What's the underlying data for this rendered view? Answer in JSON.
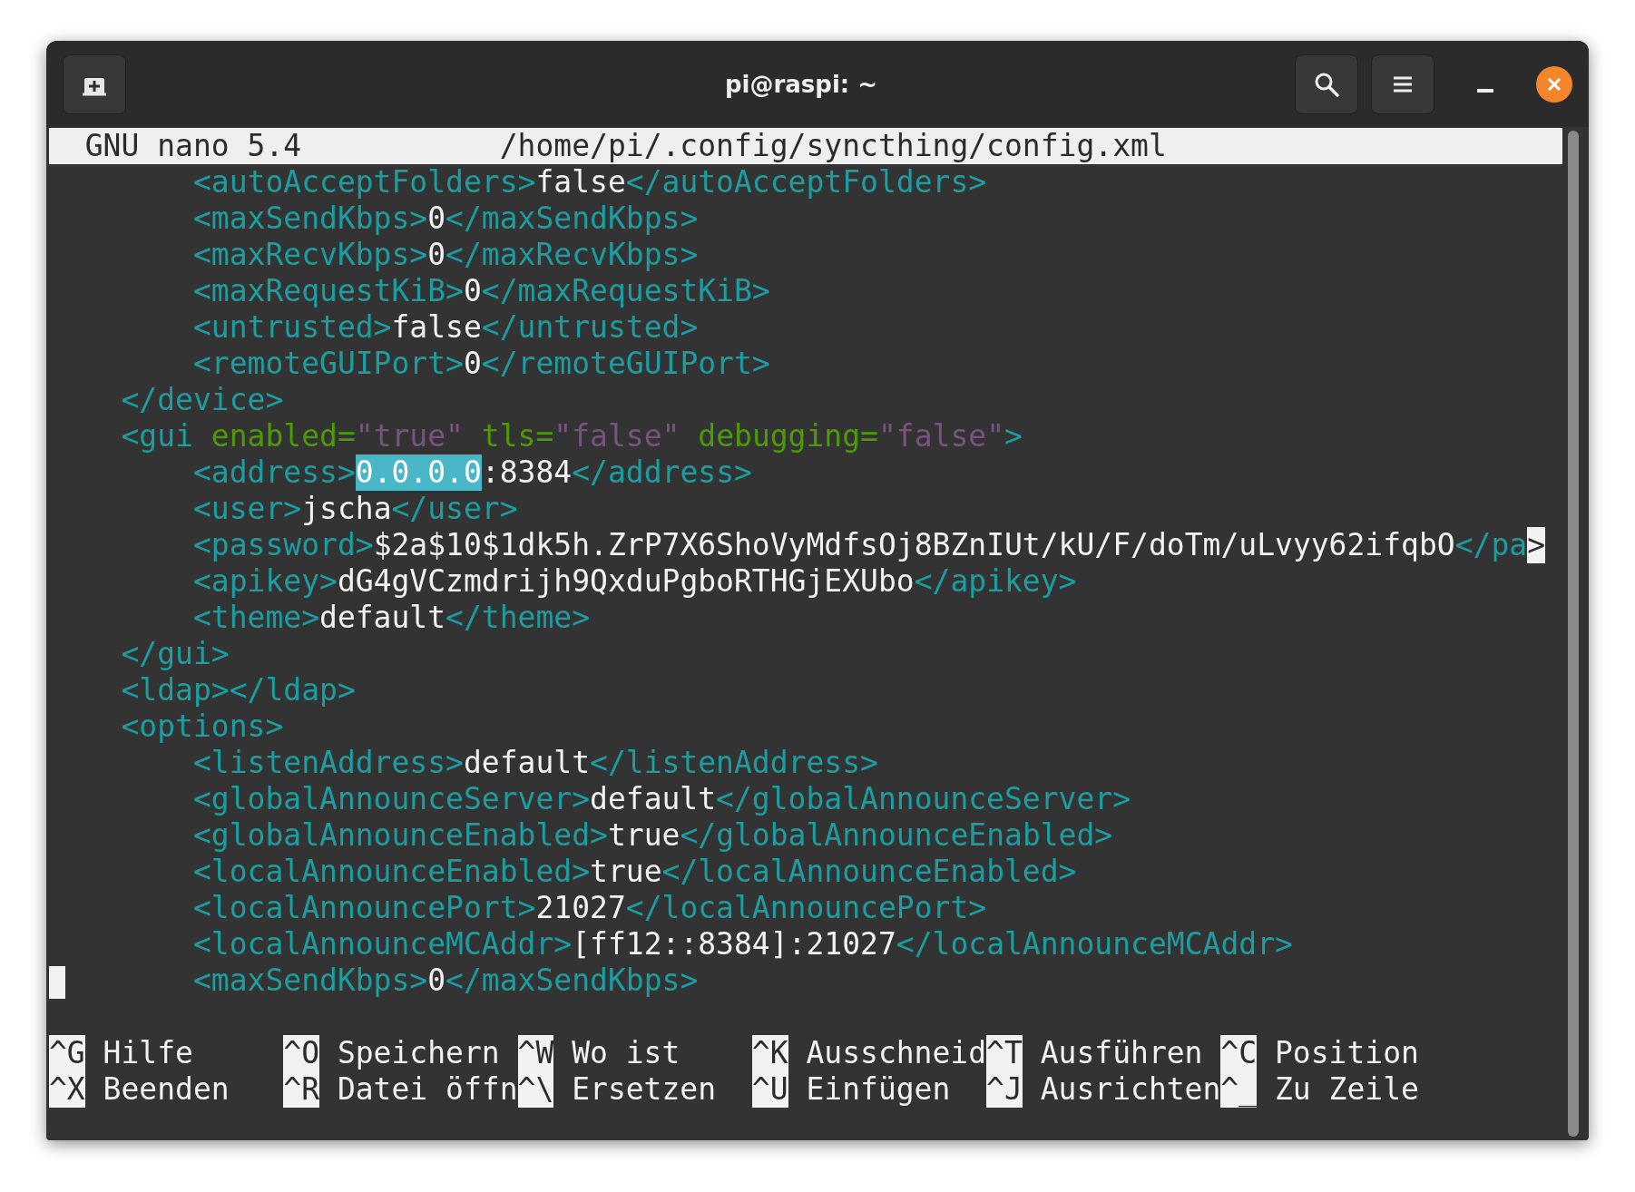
{
  "window": {
    "title": "pi@raspi: ~"
  },
  "nano_header": {
    "version": "GNU nano 5.4",
    "file": "/home/pi/.config/syncthing/config.xml"
  },
  "lines": [
    {
      "cursor": false,
      "segments": [
        {
          "kind": "tag",
          "text": "        <autoAcceptFolders>"
        },
        {
          "kind": "text",
          "text": "false"
        },
        {
          "kind": "tag",
          "text": "</autoAcceptFolders>"
        }
      ]
    },
    {
      "cursor": false,
      "segments": [
        {
          "kind": "tag",
          "text": "        <maxSendKbps>"
        },
        {
          "kind": "text",
          "text": "0"
        },
        {
          "kind": "tag",
          "text": "</maxSendKbps>"
        }
      ]
    },
    {
      "cursor": false,
      "segments": [
        {
          "kind": "tag",
          "text": "        <maxRecvKbps>"
        },
        {
          "kind": "text",
          "text": "0"
        },
        {
          "kind": "tag",
          "text": "</maxRecvKbps>"
        }
      ]
    },
    {
      "cursor": false,
      "segments": [
        {
          "kind": "tag",
          "text": "        <maxRequestKiB>"
        },
        {
          "kind": "text",
          "text": "0"
        },
        {
          "kind": "tag",
          "text": "</maxRequestKiB>"
        }
      ]
    },
    {
      "cursor": false,
      "segments": [
        {
          "kind": "tag",
          "text": "        <untrusted>"
        },
        {
          "kind": "text",
          "text": "false"
        },
        {
          "kind": "tag",
          "text": "</untrusted>"
        }
      ]
    },
    {
      "cursor": false,
      "segments": [
        {
          "kind": "tag",
          "text": "        <remoteGUIPort>"
        },
        {
          "kind": "text",
          "text": "0"
        },
        {
          "kind": "tag",
          "text": "</remoteGUIPort>"
        }
      ]
    },
    {
      "cursor": false,
      "segments": [
        {
          "kind": "tag",
          "text": "    </device>"
        }
      ]
    },
    {
      "cursor": false,
      "segments": [
        {
          "kind": "tag",
          "text": "    <gui"
        },
        {
          "kind": "attr",
          "text": " enabled="
        },
        {
          "kind": "value",
          "text": "\"true\""
        },
        {
          "kind": "attr",
          "text": " tls="
        },
        {
          "kind": "value",
          "text": "\"false\""
        },
        {
          "kind": "attr",
          "text": " debugging="
        },
        {
          "kind": "value",
          "text": "\"false\""
        },
        {
          "kind": "tag",
          "text": ">"
        }
      ]
    },
    {
      "cursor": false,
      "segments": [
        {
          "kind": "tag",
          "text": "        <address>"
        },
        {
          "kind": "selection",
          "text": "0.0.0.0"
        },
        {
          "kind": "text",
          "text": ":8384"
        },
        {
          "kind": "tag",
          "text": "</address>"
        }
      ]
    },
    {
      "cursor": false,
      "segments": [
        {
          "kind": "tag",
          "text": "        <user>"
        },
        {
          "kind": "text",
          "text": "jscha"
        },
        {
          "kind": "tag",
          "text": "</user>"
        }
      ]
    },
    {
      "cursor": false,
      "segments": [
        {
          "kind": "tag",
          "text": "        <password>"
        },
        {
          "kind": "text",
          "text": "$2a$10$1dk5h.ZrP7X6ShoVyMdfsOj8BZnIUt/kU/F/doTm/uLvyy62ifqbO"
        },
        {
          "kind": "tag",
          "text": "</pa"
        },
        {
          "kind": "overflow",
          "text": ">"
        }
      ]
    },
    {
      "cursor": false,
      "segments": [
        {
          "kind": "tag",
          "text": "        <apikey>"
        },
        {
          "kind": "text",
          "text": "dG4gVCzmdrijh9QxduPgboRTHGjEXUbo"
        },
        {
          "kind": "tag",
          "text": "</apikey>"
        }
      ]
    },
    {
      "cursor": false,
      "segments": [
        {
          "kind": "tag",
          "text": "        <theme>"
        },
        {
          "kind": "text",
          "text": "default"
        },
        {
          "kind": "tag",
          "text": "</theme>"
        }
      ]
    },
    {
      "cursor": false,
      "segments": [
        {
          "kind": "tag",
          "text": "    </gui>"
        }
      ]
    },
    {
      "cursor": false,
      "segments": [
        {
          "kind": "tag",
          "text": "    <ldap></ldap>"
        }
      ]
    },
    {
      "cursor": false,
      "segments": [
        {
          "kind": "tag",
          "text": "    <options>"
        }
      ]
    },
    {
      "cursor": false,
      "segments": [
        {
          "kind": "tag",
          "text": "        <listenAddress>"
        },
        {
          "kind": "text",
          "text": "default"
        },
        {
          "kind": "tag",
          "text": "</listenAddress>"
        }
      ]
    },
    {
      "cursor": false,
      "segments": [
        {
          "kind": "tag",
          "text": "        <globalAnnounceServer>"
        },
        {
          "kind": "text",
          "text": "default"
        },
        {
          "kind": "tag",
          "text": "</globalAnnounceServer>"
        }
      ]
    },
    {
      "cursor": false,
      "segments": [
        {
          "kind": "tag",
          "text": "        <globalAnnounceEnabled>"
        },
        {
          "kind": "text",
          "text": "true"
        },
        {
          "kind": "tag",
          "text": "</globalAnnounceEnabled>"
        }
      ]
    },
    {
      "cursor": false,
      "segments": [
        {
          "kind": "tag",
          "text": "        <localAnnounceEnabled>"
        },
        {
          "kind": "text",
          "text": "true"
        },
        {
          "kind": "tag",
          "text": "</localAnnounceEnabled>"
        }
      ]
    },
    {
      "cursor": false,
      "segments": [
        {
          "kind": "tag",
          "text": "        <localAnnouncePort>"
        },
        {
          "kind": "text",
          "text": "21027"
        },
        {
          "kind": "tag",
          "text": "</localAnnouncePort>"
        }
      ]
    },
    {
      "cursor": false,
      "segments": [
        {
          "kind": "tag",
          "text": "        <localAnnounceMCAddr>"
        },
        {
          "kind": "text",
          "text": "[ff12::8384]:21027"
        },
        {
          "kind": "tag",
          "text": "</localAnnounceMCAddr>"
        }
      ]
    },
    {
      "cursor": true,
      "segments": [
        {
          "kind": "tag",
          "text": "        <maxSendKbps>"
        },
        {
          "kind": "text",
          "text": "0"
        },
        {
          "kind": "tag",
          "text": "</maxSendKbps>"
        }
      ]
    }
  ],
  "shortcuts": [
    [
      {
        "key": "^G",
        "label": "Hilfe"
      },
      {
        "key": "^O",
        "label": "Speichern"
      },
      {
        "key": "^W",
        "label": "Wo ist"
      },
      {
        "key": "^K",
        "label": "Ausschneid"
      },
      {
        "key": "^T",
        "label": "Ausführen"
      },
      {
        "key": "^C",
        "label": "Position"
      }
    ],
    [
      {
        "key": "^X",
        "label": "Beenden"
      },
      {
        "key": "^R",
        "label": "Datei öffn"
      },
      {
        "key": "^\\",
        "label": "Ersetzen"
      },
      {
        "key": "^U",
        "label": "Einfügen"
      },
      {
        "key": "^J",
        "label": "Ausrichten"
      },
      {
        "key": "^_",
        "label": "Zu Zeile"
      }
    ]
  ]
}
